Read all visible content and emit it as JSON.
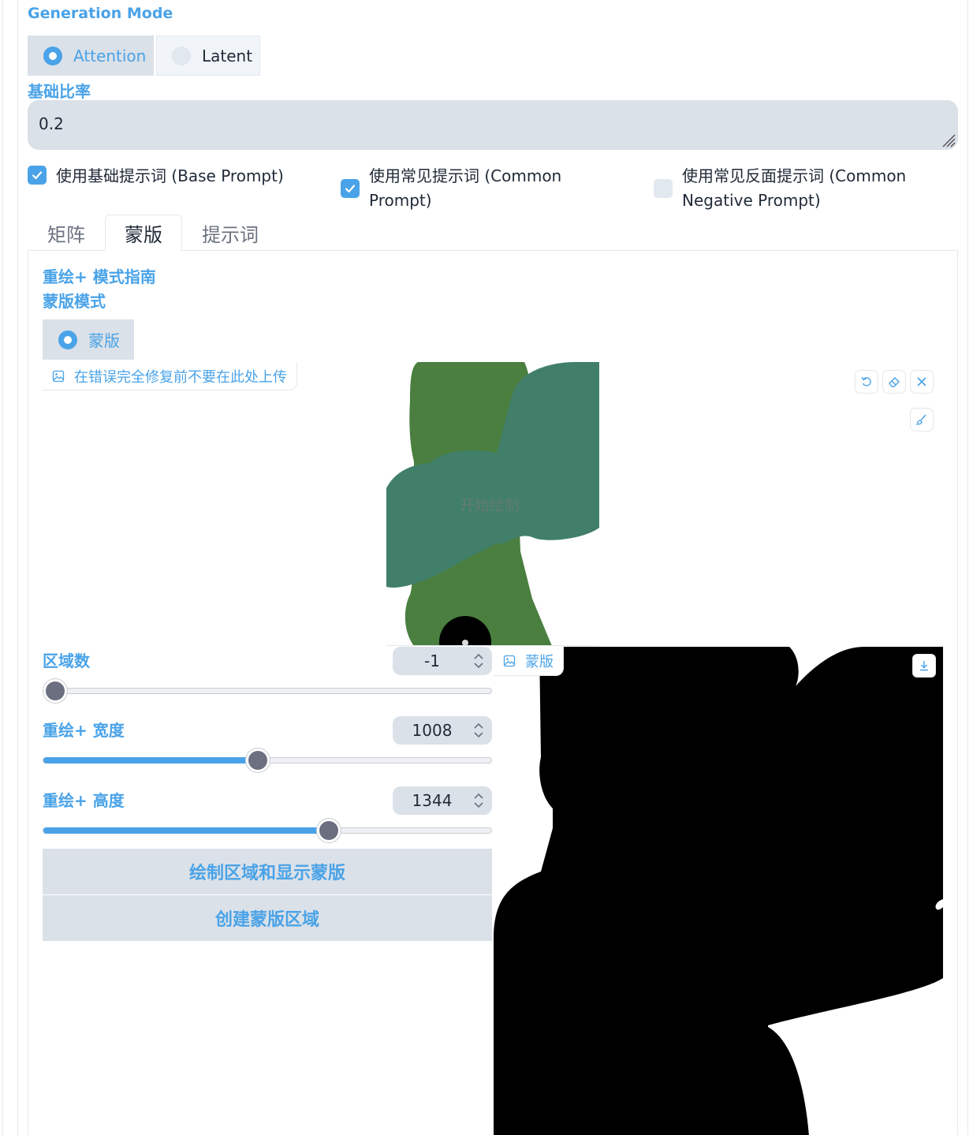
{
  "generation_mode": {
    "label": "Generation Mode",
    "options": [
      {
        "label": "Attention",
        "selected": true
      },
      {
        "label": "Latent",
        "selected": false
      }
    ]
  },
  "base_ratio": {
    "label": "基础比率",
    "value": "0.2"
  },
  "checkboxes": {
    "base_prompt": {
      "label": "使用基础提示词 (Base Prompt)",
      "checked": true
    },
    "common_prompt": {
      "label": "使用常见提示词 (Common Prompt)",
      "checked": true
    },
    "common_negative": {
      "label": "使用常见反面提示词 (Common Negative Prompt)",
      "checked": false
    }
  },
  "tabs": [
    {
      "label": "矩阵",
      "active": false
    },
    {
      "label": "蒙版",
      "active": true
    },
    {
      "label": "提示词",
      "active": false
    }
  ],
  "mask_panel": {
    "guide_title": "重绘+ 模式指南",
    "mask_mode_label": "蒙版模式",
    "mask_mode_option": "蒙版",
    "upload_badge": "在错误完全修复前不要在此处上传",
    "canvas_hint": "开始绘制",
    "region_count": {
      "label": "区域数",
      "value": "-1",
      "min": -1,
      "slider_fraction": 0.0
    },
    "width": {
      "label": "重绘+ 宽度",
      "value": "1008",
      "slider_fraction": 0.478
    },
    "height": {
      "label": "重绘+ 高度",
      "value": "1344",
      "slider_fraction": 0.637
    },
    "draw_region_button": "绘制区域和显示蒙版",
    "create_mask_button": "创建蒙版区域",
    "output_badge": "蒙版"
  },
  "colors": {
    "accent": "#4aa3e8",
    "input_bg": "#dbe1e8",
    "paint_green": "#4a7f40",
    "paint_teal": "#417f6a",
    "mask_black": "#000000"
  },
  "icons": [
    "image-icon",
    "undo-icon",
    "eraser-icon",
    "close-icon",
    "brush-icon",
    "download-icon",
    "spinner-arrows-icon"
  ]
}
